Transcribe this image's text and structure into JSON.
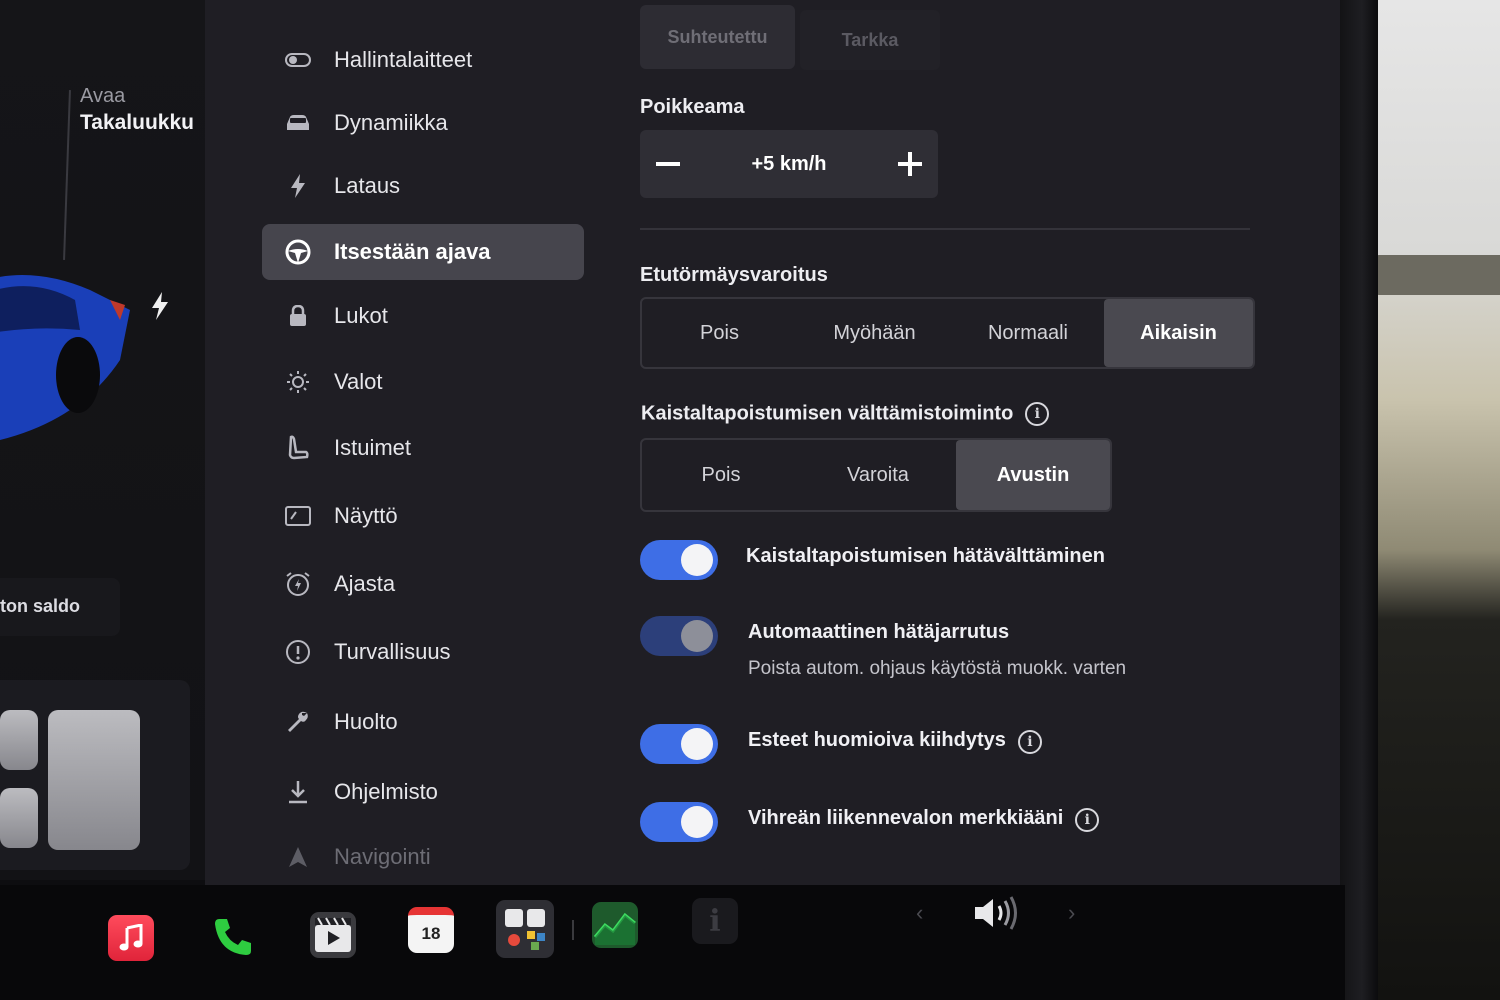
{
  "car_panel": {
    "trunk_action": "Avaa",
    "trunk_label": "Takaluukku",
    "balance_label": "ton saldo"
  },
  "sidebar": {
    "items": [
      {
        "label": "Hallintalaitteet",
        "icon": "toggle-icon"
      },
      {
        "label": "Dynamiikka",
        "icon": "car-icon"
      },
      {
        "label": "Lataus",
        "icon": "bolt-icon"
      },
      {
        "label": "Itsestään ajava",
        "icon": "steering-wheel-icon",
        "active": true
      },
      {
        "label": "Lukot",
        "icon": "lock-icon"
      },
      {
        "label": "Valot",
        "icon": "sun-icon"
      },
      {
        "label": "Istuimet",
        "icon": "seat-icon"
      },
      {
        "label": "Näyttö",
        "icon": "display-icon"
      },
      {
        "label": "Ajasta",
        "icon": "alarm-clock-icon"
      },
      {
        "label": "Turvallisuus",
        "icon": "alert-circle-icon"
      },
      {
        "label": "Huolto",
        "icon": "wrench-icon"
      },
      {
        "label": "Ohjelmisto",
        "icon": "download-icon"
      },
      {
        "label": "Navigointi",
        "icon": "navigation-icon"
      }
    ]
  },
  "speed_limit_mode": {
    "options": [
      "Suhteutettu",
      "Tarkka"
    ]
  },
  "offset": {
    "label": "Poikkeama",
    "value": "+5 km/h",
    "minus": "−",
    "plus": "+"
  },
  "forward_collision": {
    "label": "Etutörmäysvaroitus",
    "options": [
      "Pois",
      "Myöhään",
      "Normaali",
      "Aikaisin"
    ],
    "selected": "Aikaisin"
  },
  "lane_departure": {
    "label": "Kaistaltapoistumisen välttämistoiminto",
    "options": [
      "Pois",
      "Varoita",
      "Avustin"
    ],
    "selected": "Avustin"
  },
  "toggles": {
    "emergency_lane": {
      "label": "Kaistaltapoistumisen hätävälttäminen",
      "on": true
    },
    "aeb": {
      "label": "Automaattinen hätäjarrutus",
      "sub": "Poista autom. ohjaus käytöstä muokk. varten",
      "on": true,
      "disabled": true
    },
    "obstacle_accel": {
      "label": "Esteet huomioiva kiihdytys",
      "on": true
    },
    "green_light": {
      "label": "Vihreän liikennevalon merkkiääni",
      "on": true
    }
  },
  "dock": {
    "calendar_day": "18",
    "info_glyph": "i"
  },
  "colors": {
    "accent": "#3e6ee6",
    "background": "#1f1e24",
    "selected": "#4a4950"
  }
}
